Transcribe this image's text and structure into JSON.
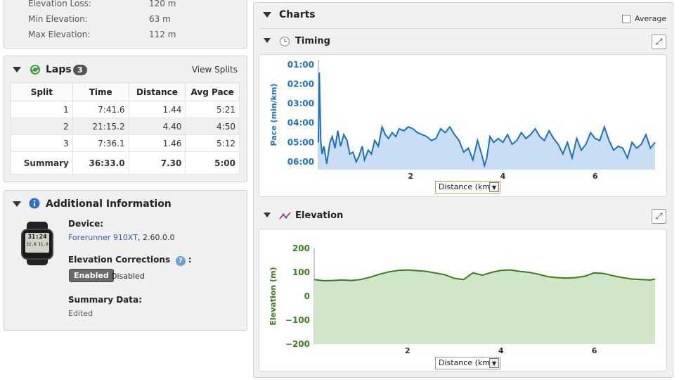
{
  "summary_stats": [
    {
      "label": "Elevation Loss:",
      "value": "120 m"
    },
    {
      "label": "Min Elevation:",
      "value": "63 m"
    },
    {
      "label": "Max Elevation:",
      "value": "112 m"
    }
  ],
  "laps": {
    "title": "Laps",
    "count": "3",
    "view_splits": "View Splits",
    "columns": [
      "Split",
      "Time",
      "Distance",
      "Avg Pace"
    ],
    "rows": [
      [
        "1",
        "7:41.6",
        "1.44",
        "5:21"
      ],
      [
        "2",
        "21:15.2",
        "4.40",
        "4:50"
      ],
      [
        "3",
        "7:36.1",
        "1.46",
        "5:12"
      ]
    ],
    "summary": [
      "Summary",
      "36:33.0",
      "7.30",
      "5:00"
    ]
  },
  "additional": {
    "title": "Additional Information",
    "device_label": "Device:",
    "device_name": "Forerunner 910XT",
    "device_version": ", 2.60.0.0",
    "watch_time": "31:24",
    "watch_sub1": "32.8",
    "watch_sub2": "11.9",
    "elev_corr_label": "Elevation Corrections",
    "elev_corr_colon": ":",
    "enabled": "Enabled",
    "disabled": "Disabled",
    "summary_label": "Summary Data:",
    "summary_value": "Edited"
  },
  "charts": {
    "title": "Charts",
    "average_label": "Average",
    "timing_title": "Timing",
    "elevation_title": "Elevation",
    "x_select": "Distance (km)"
  },
  "colors": {
    "pace": "#1a72c8",
    "pace_fill": "#c9def5",
    "elev": "#3a7d1e",
    "elev_fill": "#cfe6c8"
  },
  "chart_data": [
    {
      "type": "area",
      "name": "timing",
      "ylabel": "Pace (min/km)",
      "xlabel": "",
      "y_reversed": true,
      "ylim": [
        0.75,
        6.4
      ],
      "xlim": [
        0,
        7.3
      ],
      "yticks": [
        "01:00",
        "02:00",
        "03:00",
        "04:00",
        "05:00",
        "06:00"
      ],
      "ytick_values": [
        1,
        2,
        3,
        4,
        5,
        6
      ],
      "xticks": [
        2,
        4,
        6
      ],
      "x": [
        0,
        0.02,
        0.05,
        0.08,
        0.12,
        0.18,
        0.25,
        0.3,
        0.36,
        0.42,
        0.48,
        0.55,
        0.62,
        0.68,
        0.75,
        0.82,
        0.88,
        0.95,
        1.0,
        1.08,
        1.15,
        1.22,
        1.3,
        1.38,
        1.45,
        1.52,
        1.6,
        1.68,
        1.75,
        1.85,
        1.95,
        2.05,
        2.15,
        2.25,
        2.35,
        2.45,
        2.55,
        2.65,
        2.75,
        2.85,
        2.95,
        3.05,
        3.15,
        3.25,
        3.35,
        3.45,
        3.55,
        3.6,
        3.65,
        3.72,
        3.8,
        3.9,
        4.0,
        4.1,
        4.2,
        4.3,
        4.4,
        4.5,
        4.6,
        4.7,
        4.8,
        4.9,
        5.0,
        5.1,
        5.2,
        5.3,
        5.4,
        5.5,
        5.6,
        5.7,
        5.8,
        5.9,
        6.0,
        6.1,
        6.2,
        6.3,
        6.4,
        6.5,
        6.6,
        6.7,
        6.8,
        6.9,
        7.0,
        7.1,
        7.2,
        7.3
      ],
      "values": [
        5.0,
        1.4,
        4.9,
        5.6,
        5.2,
        6.1,
        5.0,
        4.7,
        5.3,
        4.4,
        5.2,
        4.6,
        4.9,
        5.6,
        5.5,
        6.0,
        5.7,
        5.2,
        5.9,
        5.4,
        5.6,
        4.9,
        5.2,
        4.2,
        4.6,
        4.8,
        4.5,
        4.7,
        4.3,
        4.4,
        4.2,
        4.3,
        4.5,
        4.6,
        4.7,
        4.9,
        4.8,
        4.3,
        4.5,
        4.2,
        4.6,
        4.9,
        5.5,
        5.3,
        5.9,
        4.9,
        5.7,
        6.2,
        5.8,
        4.7,
        5.0,
        4.8,
        5.0,
        4.6,
        5.1,
        4.9,
        4.5,
        4.8,
        4.6,
        4.3,
        4.7,
        4.9,
        4.4,
        4.8,
        5.1,
        5.6,
        5.0,
        5.8,
        4.8,
        5.4,
        5.1,
        4.5,
        4.8,
        4.9,
        4.2,
        4.9,
        5.4,
        5.2,
        5.3,
        5.8,
        5.0,
        5.3,
        5.1,
        4.6,
        5.3,
        5.0
      ]
    },
    {
      "type": "area",
      "name": "elevation",
      "ylabel": "Elevation (m)",
      "xlabel": "",
      "ylim": [
        -200,
        200
      ],
      "xlim": [
        0,
        7.3
      ],
      "yticks": [
        "200",
        "100",
        "0",
        "−100",
        "−200"
      ],
      "ytick_values": [
        200,
        100,
        0,
        -100,
        -200
      ],
      "xticks": [
        2,
        4,
        6
      ],
      "x": [
        0,
        0.2,
        0.4,
        0.6,
        0.8,
        1.0,
        1.2,
        1.4,
        1.6,
        1.8,
        2.0,
        2.2,
        2.4,
        2.6,
        2.8,
        3.0,
        3.2,
        3.4,
        3.6,
        3.8,
        4.0,
        4.2,
        4.4,
        4.6,
        4.8,
        5.0,
        5.2,
        5.4,
        5.6,
        5.8,
        6.0,
        6.2,
        6.4,
        6.6,
        6.8,
        7.0,
        7.2,
        7.3
      ],
      "values": [
        70,
        65,
        66,
        68,
        66,
        70,
        80,
        92,
        102,
        108,
        110,
        107,
        104,
        97,
        90,
        75,
        70,
        98,
        88,
        100,
        108,
        110,
        104,
        100,
        92,
        82,
        78,
        76,
        78,
        84,
        98,
        95,
        86,
        78,
        72,
        70,
        68,
        72
      ]
    }
  ]
}
